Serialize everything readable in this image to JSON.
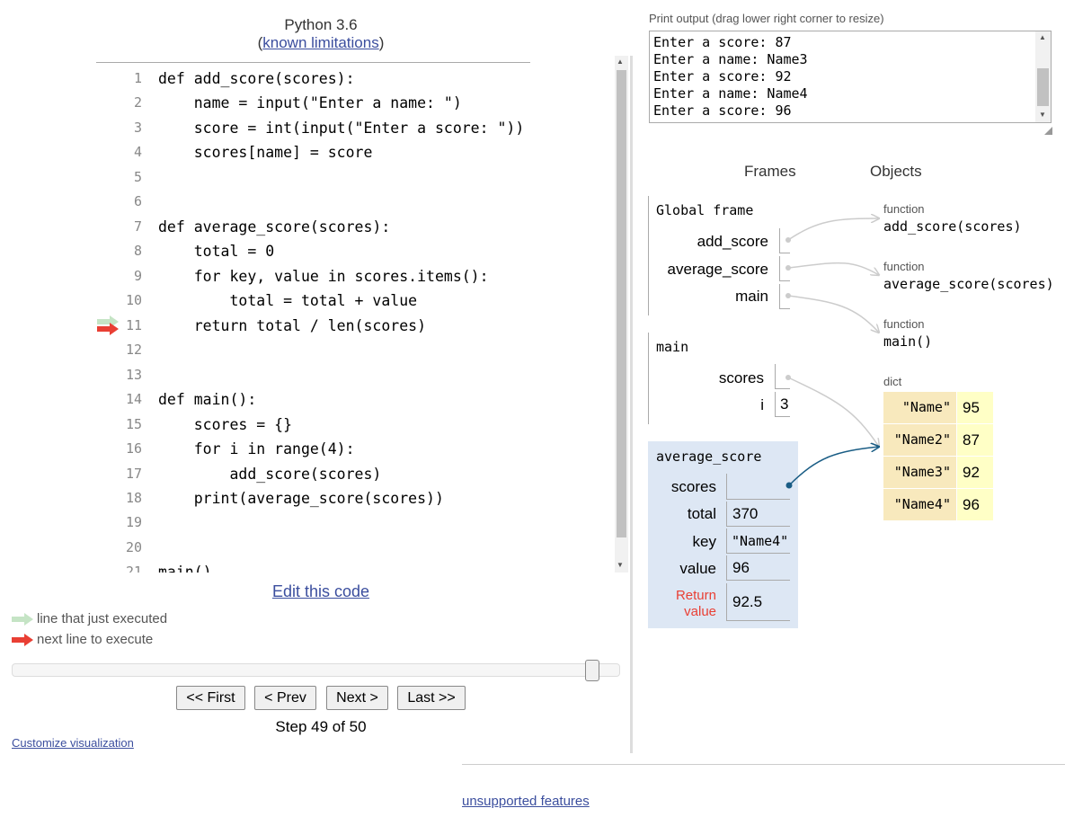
{
  "header": {
    "language": "Python 3.6",
    "limitations_prefix": "(",
    "limitations_link": "known limitations",
    "limitations_suffix": ")"
  },
  "code": {
    "lines": [
      "def add_score(scores):",
      "    name = input(\"Enter a name: \")",
      "    score = int(input(\"Enter a score: \"))",
      "    scores[name] = score",
      "",
      "",
      "def average_score(scores):",
      "    total = 0",
      "    for key, value in scores.items():",
      "        total = total + value",
      "    return total / len(scores)",
      "",
      "",
      "def main():",
      "    scores = {}",
      "    for i in range(4):",
      "        add_score(scores)",
      "    print(average_score(scores))",
      "",
      "",
      "main()"
    ],
    "just_executed_line": 11,
    "next_line": 11,
    "colors": {
      "just_executed": "#c5e4c5",
      "next": "#e93f34"
    }
  },
  "controls": {
    "edit_link": "Edit this code",
    "legend_executed": "line that just executed",
    "legend_next": "next line to execute",
    "first": "<< First",
    "prev": "< Prev",
    "next": "Next >",
    "last": "Last >>",
    "step_text": "Step 49 of 50",
    "step_current": 49,
    "step_total": 50,
    "customize": "Customize visualization"
  },
  "footer": {
    "unsupported": "unsupported features"
  },
  "output": {
    "label": "Print output (drag lower right corner to resize)",
    "lines": [
      "Enter a score: 87",
      "Enter a name: Name3",
      "Enter a score: 92",
      "Enter a name: Name4",
      "Enter a score: 96"
    ]
  },
  "viz": {
    "frames_header": "Frames",
    "objects_header": "Objects",
    "global": {
      "title": "Global frame",
      "vars": [
        "add_score",
        "average_score",
        "main"
      ]
    },
    "main": {
      "title": "main",
      "vars": [
        {
          "name": "scores",
          "value": ""
        },
        {
          "name": "i",
          "value": "3"
        }
      ]
    },
    "avg": {
      "title": "average_score",
      "vars": [
        {
          "name": "scores",
          "value": ""
        },
        {
          "name": "total",
          "value": "370"
        },
        {
          "name": "key",
          "value": "\"Name4\""
        },
        {
          "name": "value",
          "value": "96"
        }
      ],
      "return_label_1": "Return",
      "return_label_2": "value",
      "return_value": "92.5"
    },
    "objects": [
      {
        "type": "function",
        "value": "add_score(scores)"
      },
      {
        "type": "function",
        "value": "average_score(scores)"
      },
      {
        "type": "function",
        "value": "main()"
      }
    ],
    "dict": {
      "type": "dict",
      "entries": [
        {
          "key": "\"Name\"",
          "value": "95"
        },
        {
          "key": "\"Name2\"",
          "value": "87"
        },
        {
          "key": "\"Name3\"",
          "value": "92"
        },
        {
          "key": "\"Name4\"",
          "value": "96"
        }
      ]
    },
    "colors": {
      "active_frame": "#dde7f4",
      "dict_key": "#f8e9bd",
      "dict_value": "#ffffc6",
      "active_arrow": "#1a5d85",
      "inactive_arrow": "#cccccc",
      "return_label": "#e93f34"
    }
  }
}
